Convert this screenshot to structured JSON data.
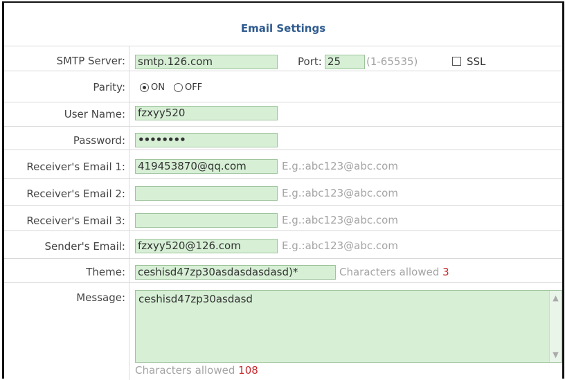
{
  "title": "Email Settings",
  "smtp": {
    "label": "SMTP Server:",
    "value": "smtp.126.com",
    "port_label": "Port:",
    "port_value": "25",
    "port_range": "(1-65535)",
    "ssl_label": "SSL"
  },
  "parity": {
    "label": "Parity:",
    "on": "ON",
    "off": "OFF"
  },
  "username": {
    "label": "User Name:",
    "value": "fzxyy520"
  },
  "password": {
    "label": "Password:",
    "value": "••••••••"
  },
  "receiver1": {
    "label": "Receiver's Email 1:",
    "value": "419453870@qq.com",
    "hint": "E.g.:abc123@abc.com"
  },
  "receiver2": {
    "label": "Receiver's Email 2:",
    "value": "",
    "hint": "E.g.:abc123@abc.com"
  },
  "receiver3": {
    "label": "Receiver's Email 3:",
    "value": "",
    "hint": "E.g.:abc123@abc.com"
  },
  "sender": {
    "label": "Sender's Email:",
    "value": "fzxyy520@126.com",
    "hint": "E.g.:abc123@abc.com"
  },
  "theme": {
    "label": "Theme:",
    "value": "ceshisd47zp30asdasdasdasd)*",
    "allowed_label": "Characters allowed",
    "allowed_count": "3"
  },
  "message": {
    "label": "Message:",
    "value": "ceshisd47zp30asdasd",
    "allowed_label": "Characters allowed",
    "allowed_count": "108"
  }
}
